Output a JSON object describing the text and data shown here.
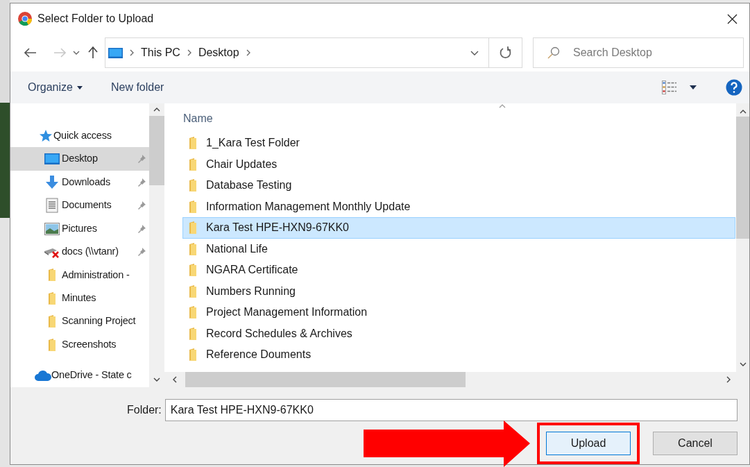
{
  "window": {
    "title": "Select Folder to Upload"
  },
  "address_bar": {
    "path": [
      "This PC",
      "Desktop"
    ]
  },
  "search": {
    "placeholder": "Search Desktop"
  },
  "toolbar": {
    "organize": "Organize",
    "new_folder": "New folder"
  },
  "sidebar": {
    "items": [
      {
        "label": "Quick access",
        "kind": "star",
        "pinned": false,
        "selected": false
      },
      {
        "label": "Desktop",
        "kind": "desktop",
        "pinned": true,
        "selected": true
      },
      {
        "label": "Downloads",
        "kind": "download",
        "pinned": true,
        "selected": false
      },
      {
        "label": "Documents",
        "kind": "document",
        "pinned": true,
        "selected": false
      },
      {
        "label": "Pictures",
        "kind": "picture",
        "pinned": true,
        "selected": false
      },
      {
        "label": "docs (\\\\vtanr)",
        "kind": "drive",
        "pinned": true,
        "selected": false
      },
      {
        "label": "Administration -",
        "kind": "folder",
        "pinned": false,
        "selected": false
      },
      {
        "label": "Minutes",
        "kind": "folder",
        "pinned": false,
        "selected": false
      },
      {
        "label": "Scanning Project",
        "kind": "folder",
        "pinned": false,
        "selected": false
      },
      {
        "label": "Screenshots",
        "kind": "folder",
        "pinned": false,
        "selected": false
      },
      {
        "label": "OneDrive - State c",
        "kind": "cloud",
        "pinned": false,
        "selected": false
      }
    ]
  },
  "file_list": {
    "column": "Name",
    "rows": [
      {
        "name": "1_Kara Test Folder",
        "selected": false
      },
      {
        "name": "Chair Updates",
        "selected": false
      },
      {
        "name": "Database Testing",
        "selected": false
      },
      {
        "name": "Information Management Monthly Update",
        "selected": false
      },
      {
        "name": "Kara Test HPE-HXN9-67KK0",
        "selected": true
      },
      {
        "name": "National Life",
        "selected": false
      },
      {
        "name": "NGARA Certificate",
        "selected": false
      },
      {
        "name": "Numbers Running",
        "selected": false
      },
      {
        "name": "Project Management Information",
        "selected": false
      },
      {
        "name": "Record Schedules & Archives",
        "selected": false
      },
      {
        "name": "Reference Douments",
        "selected": false
      }
    ]
  },
  "folder_field": {
    "label": "Folder:",
    "value": "Kara Test HPE-HXN9-67KK0"
  },
  "buttons": [
    {
      "label": "Upload",
      "highlighted": true
    },
    {
      "label": "Cancel",
      "highlighted": false
    }
  ]
}
